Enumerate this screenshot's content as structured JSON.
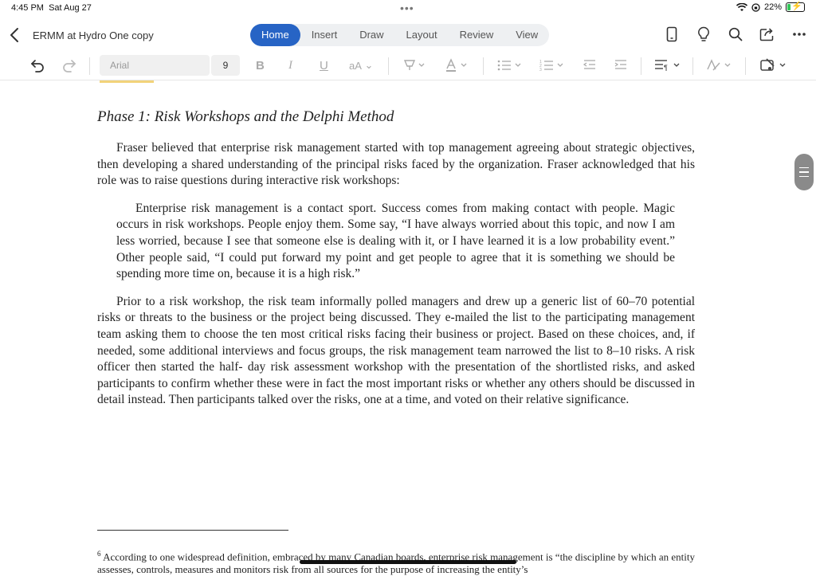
{
  "status": {
    "time": "4:45 PM",
    "date": "Sat Aug 27",
    "battery_percent": "22%",
    "battery_level": 0.22
  },
  "header": {
    "document_title": "ERMM at Hydro One copy",
    "tabs": [
      {
        "label": "Home",
        "active": true
      },
      {
        "label": "Insert",
        "active": false
      },
      {
        "label": "Draw",
        "active": false
      },
      {
        "label": "Layout",
        "active": false
      },
      {
        "label": "Review",
        "active": false
      },
      {
        "label": "View",
        "active": false
      }
    ],
    "right_icons": [
      "phone-view-icon",
      "lightbulb-icon",
      "search-icon",
      "share-icon",
      "more-icon"
    ]
  },
  "toolbar": {
    "font_name": "Arial",
    "font_size": "9",
    "bold": "B",
    "italic": "I",
    "underline": "U",
    "text_size": "aA"
  },
  "document": {
    "heading": "Phase 1:  Risk Workshops and the Delphi Method",
    "paragraph1": "Fraser believed that enterprise risk management started with top management agreeing about strategic objectives, then developing a shared understanding of the principal risks faced by the organization. Fraser acknowledged that his role was to raise questions during interactive risk workshops:",
    "quote": "Enterprise risk management is a contact sport. Success comes from making contact with people. Magic occurs in risk workshops. People enjoy them. Some say, “I have always worried about this topic, and now I am less worried, because I see that someone else is dealing with it, or I have learned it is a low probability event.” Other people said, “I could put forward my point and get people to agree that it is something we should be spending more time on, because it is a high risk.”",
    "paragraph2": "Prior to a risk workshop, the risk team informally polled managers and drew up a generic list of 60–70 potential risks or threats to the business or the project being discussed. They e-mailed the list to the participating management team asking them to choose the ten most critical risks facing their  business or project. Based on these choices, and, if needed, some additional interviews and focus groups, the risk management team narrowed the list to 8–10 risks. A risk officer then started the half- day risk assessment workshop with the presentation of the shortlisted risks, and asked participants to confirm whether these were in fact the most important risks or whether any others should be discussed in detail instead. Then participants talked over the risks, one at a time, and voted on their relative significance.",
    "footnote_number": "6",
    "footnote_text": "According to one widespread definition, embraced by many Canadian boards, enterprise risk management is “the discipline by which an entity assesses, controls, measures and monitors risk from all sources for the purpose of increasing the entity’s"
  }
}
